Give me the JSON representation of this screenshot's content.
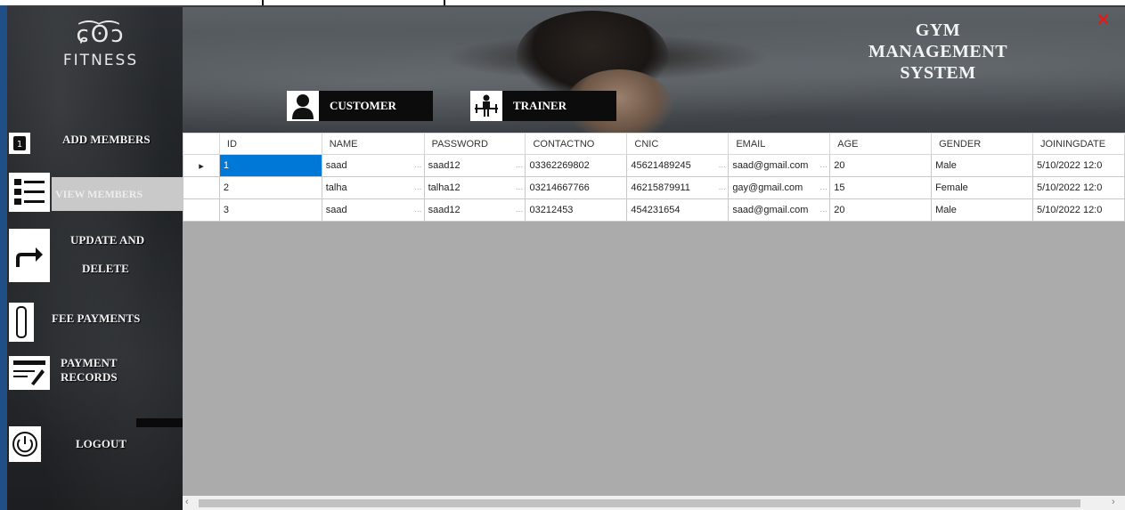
{
  "app": {
    "logo_mark": "ɕ͡ʘ͡ɔ",
    "logo_text": "FITNESS",
    "title_lines": [
      "GYM",
      "MANAGEMENT",
      "SYSTEM"
    ],
    "close_glyph": "✕"
  },
  "header_buttons": {
    "customer": "CUSTOMER",
    "trainer": "TRAINER"
  },
  "sidebar": {
    "add_members": "ADD MEMBERS",
    "view_members": "VIEW MEMBERS",
    "update_line1": "UPDATE AND",
    "update_line2": "DELETE",
    "fee_payments": "FEE PAYMENTS",
    "payment_line1": "PAYMENT",
    "payment_line2": "RECORDS",
    "logout": "LOGOUT"
  },
  "grid": {
    "columns": [
      "ID",
      "NAME",
      "PASSWORD",
      "CONTACTNO",
      "CNIC",
      "EMAIL",
      "AGE",
      "GENDER",
      "JOININGDATE"
    ],
    "rows": [
      [
        "1",
        "saad",
        "saad12",
        "03362269802",
        "45621489245",
        "saad@gmail.com",
        "20",
        "Male",
        "5/10/2022 12:0"
      ],
      [
        "2",
        "talha",
        "talha12",
        "03214667766",
        "46215879911",
        "gay@gmail.com",
        "15",
        "Female",
        "5/10/2022 12:0"
      ],
      [
        "3",
        "saad",
        "saad12",
        "03212453",
        "454231654",
        "saad@gmail.com",
        "20",
        "Male",
        "5/10/2022 12:0"
      ]
    ],
    "current_row_marker": "▸"
  },
  "colors": {
    "selection": "#0078d7",
    "close": "#d42020",
    "frame": "#1f4f86"
  }
}
